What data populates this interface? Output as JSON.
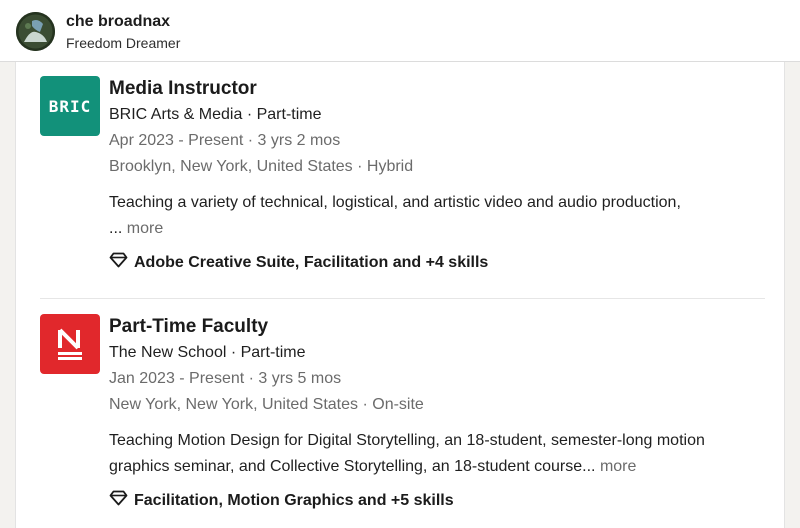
{
  "profile": {
    "name": "che broadnax",
    "headline": "Freedom Dreamer"
  },
  "experiences": [
    {
      "logo_text": "BRIC",
      "title": "Media Instructor",
      "company_line": "BRIC Arts & Media · Part-time",
      "dates": "Apr 2023 - Present · 3 yrs 2 mos",
      "location": "Brooklyn, New York, United States · Hybrid",
      "description_1": "Teaching a variety of technical, logistical, and artistic video and audio production,",
      "description_2": "...",
      "more_label": "more",
      "skills": "Adobe Creative Suite, Facilitation and +4 skills"
    },
    {
      "title": "Part-Time Faculty",
      "company_line": "The New School · Part-time",
      "dates": "Jan 2023 - Present · 3 yrs 5 mos",
      "location": "New York, New York, United States · On-site",
      "description_1": "Teaching Motion Design for Digital Storytelling, an 18-student, semester-long motion",
      "description_2": "graphics seminar, and Collective Storytelling, an 18-student course...",
      "more_label": "more",
      "skills": "Facilitation, Motion Graphics and +5 skills"
    }
  ],
  "colors": {
    "bric_logo": "#12917a",
    "new_school_logo": "#e1282c"
  },
  "icons": {
    "skills_icon": "diamond-icon"
  }
}
